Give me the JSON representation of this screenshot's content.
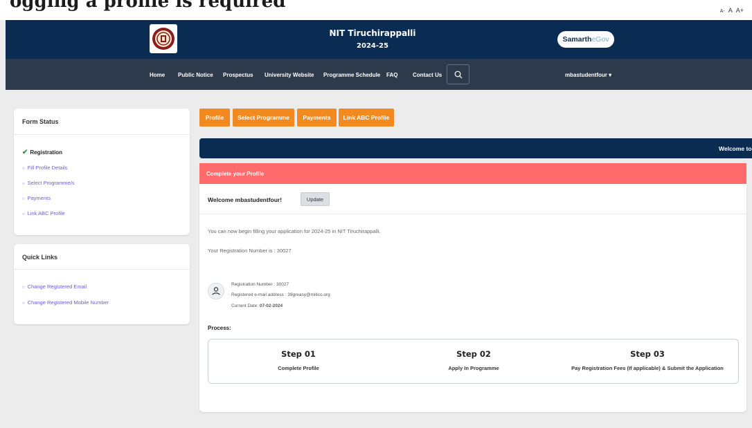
{
  "top_strip": {
    "partial_text": "ogging a profile is required",
    "font_controls": [
      "A-",
      "A",
      "A+"
    ]
  },
  "header": {
    "institute_name": "NIT Tiruchirappalli",
    "academic_year": "2024-25",
    "brand_main": "Samarth",
    "brand_suffix": "eGov"
  },
  "nav": {
    "items": [
      "Home",
      "Public Notice",
      "Prospectus",
      "University Website",
      "Programme Schedule",
      "FAQ",
      "Contact Us"
    ],
    "user": "mbastudentfour"
  },
  "form_status": {
    "title": "Form Status",
    "completed": "Registration",
    "pending": [
      "Fill Profile Details",
      "Select Programme/s",
      "Payments",
      "Link ABC Profile"
    ]
  },
  "quick_links": {
    "title": "Quick Links",
    "items": [
      "Change Registered Email",
      "Change Registered Mobile Number"
    ]
  },
  "tabs": [
    "Profile",
    "Select Programme",
    "Payments",
    "Link ABC Profile"
  ],
  "welcome_marquee": "Welcome to",
  "alert": "Complete your Profile",
  "profile": {
    "welcome": "Welcome mbastudentfour!",
    "update_label": "Update",
    "info_text": "You can now begin filling your application for 2024-25 in NIT Tiruchirappalli.",
    "reg_text": "Your Registration Number is : 30027",
    "reg_number_line": "Registration Number :  30027",
    "email_line": "Registered e-mail address :  39greasy@mitico.org",
    "date_label": "Current Date: ",
    "date_value": "07-02-2024",
    "process_label": "Process:"
  },
  "steps": [
    {
      "title": "Step 01",
      "desc": "Complete Profile"
    },
    {
      "title": "Step 02",
      "desc": "Apply In Programme"
    },
    {
      "title": "Step 03",
      "desc": "Pay Registration Fees (If applicable) & Submit the Application"
    }
  ],
  "colors": {
    "header_bg": "#0a2c53",
    "nav_bg": "#2c3a4b",
    "tab_orange": "#f28a1f",
    "alert_red": "#ff6b6b",
    "link_purple": "#6b5fd0",
    "check_green": "#2e9e3a"
  }
}
